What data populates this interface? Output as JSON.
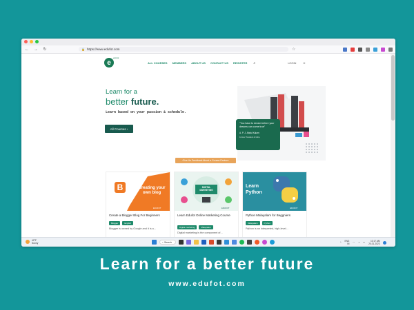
{
  "browser": {
    "url": "https://www.edufot.com"
  },
  "site": {
    "logo_letter": "e",
    "logo_text": "edufot",
    "nav": [
      {
        "label": "ALL COURSES"
      },
      {
        "label": "MEMBERS"
      },
      {
        "label": "ABOUT US"
      },
      {
        "label": "CONTACT US"
      },
      {
        "label": "REGISTER"
      }
    ],
    "login_label": "LOGIN",
    "account_label": "H"
  },
  "hero": {
    "line1": "Learn for a",
    "line2_prefix": "better ",
    "line2_bold": "future.",
    "subtitle": "Learn based on your passion & schedule.",
    "cta_label": "All Courses"
  },
  "quote": {
    "text": "\"You have to dream before your dreams can come true\"",
    "author": "A. P. J. Abdul Kalam",
    "role": "Former President of India"
  },
  "feedback_label": "Give Us Feedback About a Course Feature",
  "cards": [
    {
      "thumb_text": "Creating your own blog",
      "title": "Create a Blogger Blog For Beginners",
      "tags": [
        "Blogger",
        "English"
      ],
      "desc": "Blogger is owned by Google and it is a...",
      "brand": "EDUFOT"
    },
    {
      "thumb_text": "DIGITAL MARKETING",
      "title": "Learn Edufot Online Marketing Course",
      "tags": [
        "Digital marketing",
        "Malayalam"
      ],
      "desc": "Digital marketing is the component of...",
      "brand": "EDUFOT"
    },
    {
      "thumb_text": "Learn Python",
      "title": "Python Malayalam for Beggniers",
      "tags": [
        "Malayalam",
        "Python"
      ],
      "desc": "Python is an interpreted, high-level...",
      "brand": "EDUFOT"
    }
  ],
  "taskbar": {
    "temp": "42°F",
    "weather": "Sunny",
    "search_label": "Search",
    "lang1": "ENG",
    "lang2": "IN",
    "time": "10:17 AM",
    "date": "20-01-2023"
  },
  "caption": {
    "headline": "Learn for a better future",
    "url": "www.edufot.com"
  },
  "colors": {
    "background": "#13969a",
    "brand_green": "#1e8a6a",
    "dark_green": "#185a4e",
    "orange": "#e8a45a"
  }
}
